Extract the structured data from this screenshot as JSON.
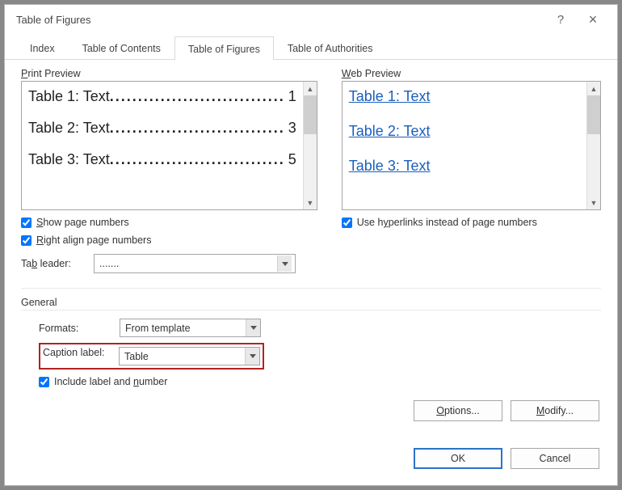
{
  "title": "Table of Figures",
  "titlebar": {
    "help": "?",
    "close": "×"
  },
  "tabs": {
    "index": "Index",
    "toc": "Table of Contents",
    "tof": "Table of Figures",
    "toa": "Table of Authorities"
  },
  "print_preview": {
    "label_pre": "P",
    "label_post": "rint Preview",
    "items": [
      {
        "label": "Table 1: Text",
        "page": "1"
      },
      {
        "label": "Table 2: Text",
        "page": "3"
      },
      {
        "label": "Table 3: Text",
        "page": "5"
      }
    ]
  },
  "web_preview": {
    "label_pre": "W",
    "label_post": "eb Preview",
    "items": [
      "Table 1: Text",
      "Table 2: Text",
      "Table 3: Text"
    ]
  },
  "options": {
    "show_pages_pre": "S",
    "show_pages_post": "how page numbers",
    "right_align_pre": "R",
    "right_align_post": "ight align page numbers",
    "use_links_pre": "Use h",
    "use_links_ul": "y",
    "use_links_post": "perlinks instead of page numbers"
  },
  "tab_leader": {
    "label_pre": "Ta",
    "label_ul": "b",
    "label_post": " leader:",
    "value": "......."
  },
  "general": {
    "label": "General",
    "formats_label_pre": "Forma",
    "formats_label_ul": "t",
    "formats_label_post": "s:",
    "formats_value": "From template",
    "caption_label_pre": "Caption ",
    "caption_label_ul": "l",
    "caption_label_post": "abel:",
    "caption_value": "Table",
    "include_pre": "Include label and ",
    "include_ul": "n",
    "include_post": "umber"
  },
  "buttons": {
    "options": "Options...",
    "modify": "Modify...",
    "ok": "OK",
    "cancel": "Cancel"
  },
  "dots": "..............................."
}
